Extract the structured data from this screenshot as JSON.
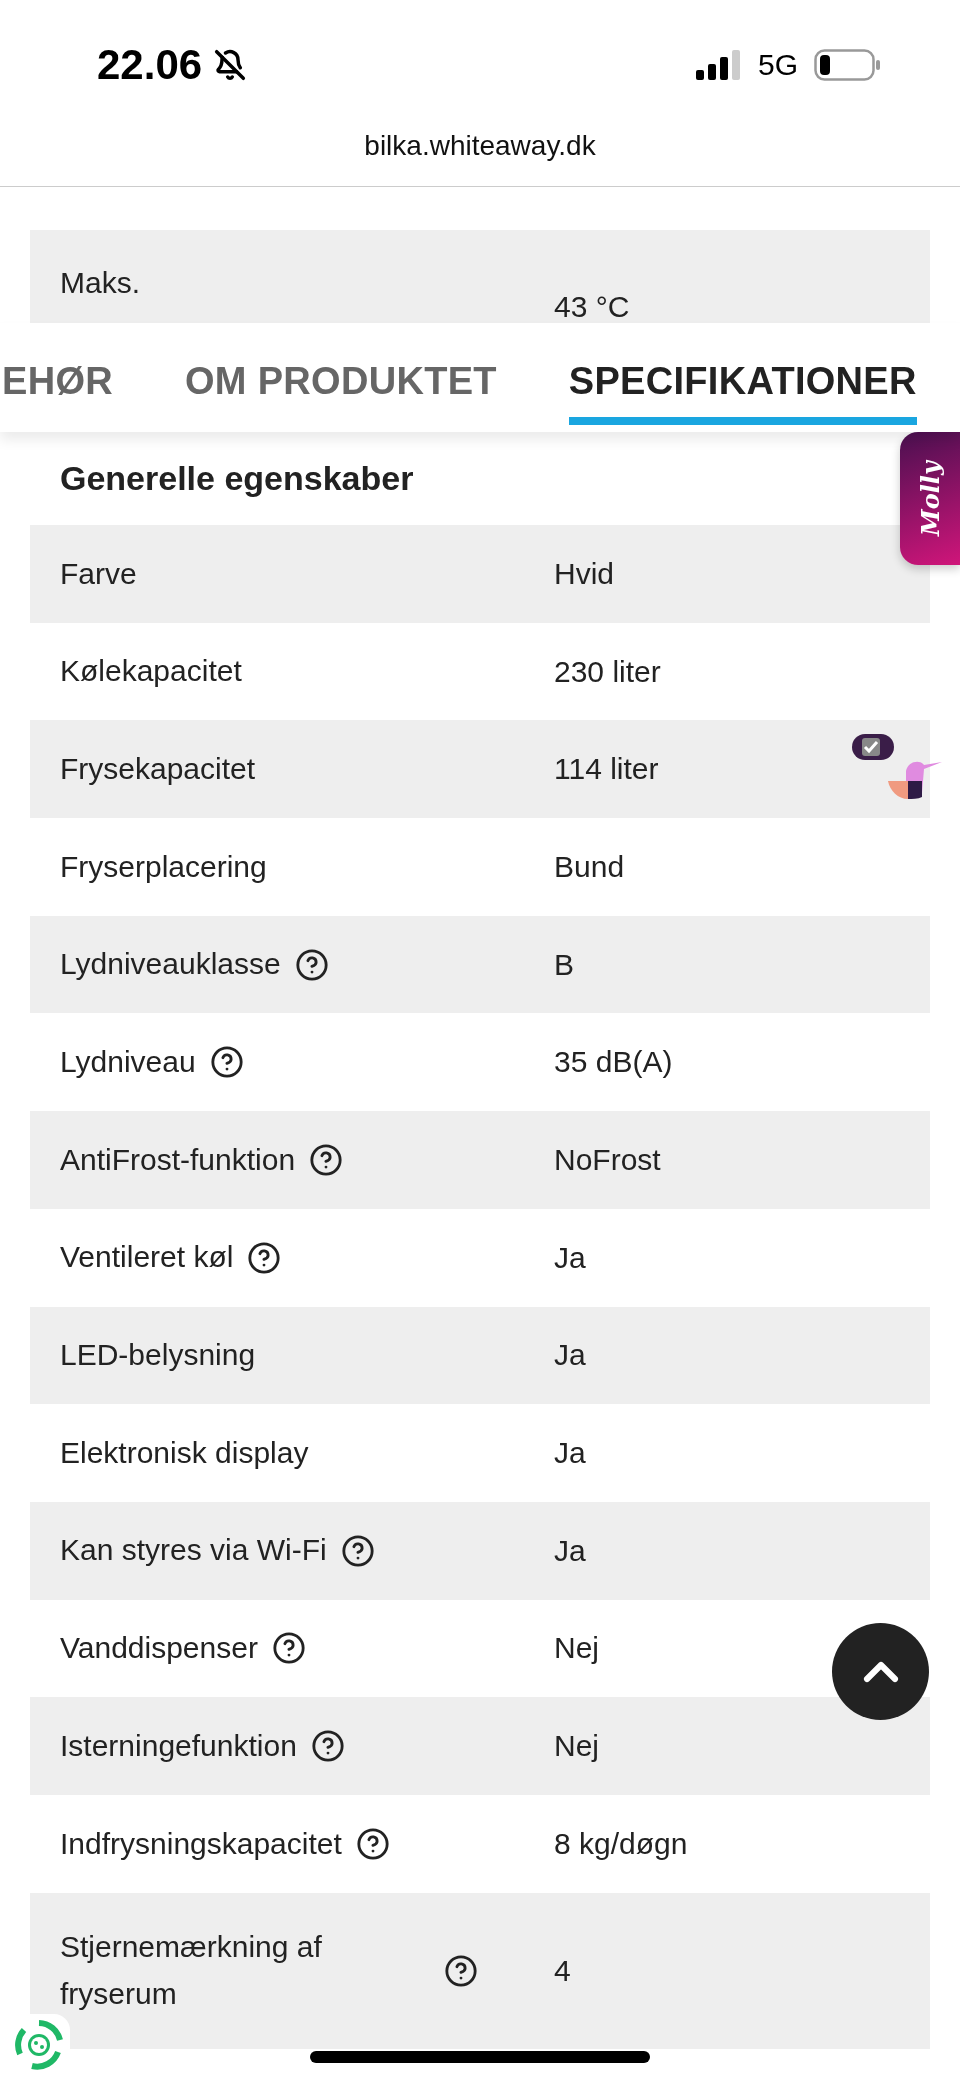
{
  "status_bar": {
    "time": "22.06",
    "network": "5G"
  },
  "address_bar": {
    "url": "bilka.whiteaway.dk"
  },
  "partial_row": {
    "label": "Maks.",
    "value": "43 °C"
  },
  "tabs": [
    {
      "label": "EHØR",
      "selected": false
    },
    {
      "label": "OM PRODUKTET",
      "selected": false
    },
    {
      "label": "SPECIFIKATIONER",
      "selected": true
    }
  ],
  "section": {
    "title": "Generelle egenskaber"
  },
  "rows": [
    {
      "label": "Farve",
      "value": "Hvid",
      "help": false
    },
    {
      "label": "Kølekapacitet",
      "value": "230 liter",
      "help": false
    },
    {
      "label": "Frysekapacitet",
      "value": "114 liter",
      "help": false
    },
    {
      "label": "Fryserplacering",
      "value": "Bund",
      "help": false
    },
    {
      "label": "Lydniveauklasse",
      "value": "B",
      "help": true
    },
    {
      "label": "Lydniveau",
      "value": "35 dB(A)",
      "help": true
    },
    {
      "label": "AntiFrost-funktion",
      "value": "NoFrost",
      "help": true
    },
    {
      "label": "Ventileret køl",
      "value": "Ja",
      "help": true
    },
    {
      "label": "LED-belysning",
      "value": "Ja",
      "help": false
    },
    {
      "label": "Elektronisk display",
      "value": "Ja",
      "help": false
    },
    {
      "label": "Kan styres via Wi-Fi",
      "value": "Ja",
      "help": true
    },
    {
      "label": "Vanddispenser",
      "value": "Nej",
      "help": true
    },
    {
      "label": "Isterningefunktion",
      "value": "Nej",
      "help": true
    },
    {
      "label": "Indfrysningskapacitet",
      "value": "8 kg/døgn",
      "help": true
    },
    {
      "label": "Stjernemærkning af fryserum",
      "value": "4",
      "help": true
    }
  ],
  "chat_tab": {
    "label": "Molly"
  }
}
